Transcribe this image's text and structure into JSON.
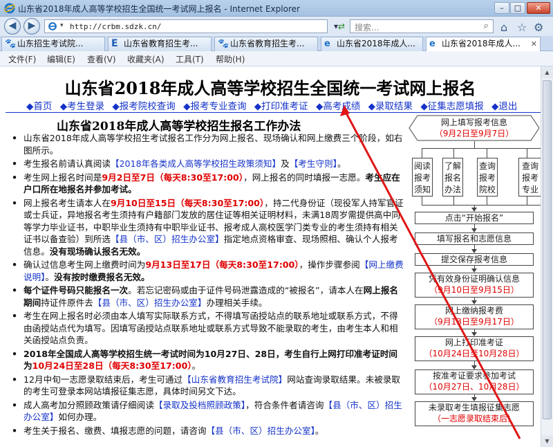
{
  "window": {
    "title": "山东省2018年成人高等学校招生全国统一考试网上报名 - Internet Explorer"
  },
  "address": {
    "url": "http://crbm.sdzk.cn/"
  },
  "search": {
    "placeholder": "搜索..."
  },
  "tabs": [
    {
      "label": "山东招生考试院..."
    },
    {
      "label": "山东省教育招生考..."
    },
    {
      "label": "山东省教育招生考..."
    },
    {
      "label": "山东省2018年成人..."
    },
    {
      "label": "山东省2018年成人..."
    }
  ],
  "menu": [
    "文件(F)",
    "编辑(E)",
    "查看(V)",
    "收藏夹(A)",
    "工具(T)",
    "帮助(H)"
  ],
  "page": {
    "title": "山东省2018年成人高等学校招生全国统一考试网上报名",
    "nav": [
      "◆首页",
      "◆考生登录",
      "◆报考院校查询",
      "◆报考专业查询",
      "◆打印准考证",
      "◆高考成绩",
      "◆录取结果",
      "◆征集志愿填报",
      "◆退出"
    ],
    "heading": "山东省2018年成人高等学校招生报名工作办法",
    "items": [
      {
        "p1": "山东省2018年成人高等学校招生考试报名工作分为网上报名、现场确认和网上缴费三个阶段，如右图所示。"
      },
      {
        "p1": "考生报名前请认真阅读",
        "link1": "【2018年各类成人高等学校招生政策须知】",
        "p2": "及",
        "link2": "【考生守则】",
        "p3": "。"
      },
      {
        "p1": "考生网上报名时间是",
        "r1": "9月2日至7日（每天8:30至17:00）",
        "p2": "，网上报名的同时填报一志愿。",
        "b1": "考生应在户口所在地报名并参加考试。"
      },
      {
        "p1": "网上报名考生请本人在",
        "r1": "9月10日至15日（每天8:30至17:00）",
        "p2": "，持二代身份证（现役军人持军官证或士兵证，异地报名考生须持有户籍部门发放的居住证等相关证明材料，未满18周岁需提供高中同等学力毕业证书，中职毕业生须持有中职毕业证书、报考成人高校医学门类专业的考生须持有相关证书以备查验）到所选",
        "link1": "【县（市、区）招生办公室】",
        "p3": "指定地点资格审查、现场照相、确认个人报考信息。",
        "b1": "没有现场确认报名无效。"
      },
      {
        "p1": "确认过信息考生网上缴费时间为",
        "r1": "9月13日至17日（每天8:30至17:00）",
        "p2": "，操作步骤参阅",
        "link1": "【网上缴费说明】",
        "p3": "。",
        "b1": "没有按时缴费报名无效。"
      },
      {
        "b1": "每个证件号码只能报名一次",
        "p1": "。若忘记密码或由于证件号码泄露造成的“被报名”，请本人在",
        "b2": "网上报名期间",
        "p2": "持证件原件去",
        "link1": "【县（市、区）招生办公室】",
        "p3": "办理相关手续。"
      },
      {
        "p1": "考生在网上报名时必须由本人填写实际联系方式，不得填写函授站点的联系地址或联系方式，不得由函授站点代为填写。因填写函授站点联系地址或联系方式导致不能录取的考生，由考生本人和相关函授站点负责。"
      },
      {
        "b1": "2018年全国成人高等学校招生统一考试时间为10月27日、28日，考生自行上网打印准考证时间为",
        "r1": "10月24日至28日（每天8:30至17:00）",
        "p1": "。"
      },
      {
        "p1": "12月中旬一志愿录取结束后，考生可通过",
        "link1": "【山东省教育招生考试院】",
        "p2": "网站查询录取结果。未被录取的考生可登录本网站填报征集志愿，具体时间另文下达。"
      },
      {
        "p1": "成人高考加分照顾政策请仔细阅读",
        "link1": "【录取及投档照顾政策】",
        "p2": "，符合条件者请咨询",
        "link2": "【县（市、区）招生办公室】",
        "p3": "如何办理。"
      },
      {
        "p1": "考生关于报名、缴费、填报志愿的问题，请咨询",
        "link1": "【县（市、区）招生办公室】",
        "p2": "。"
      }
    ]
  },
  "flow": {
    "top": {
      "label": "网上填写报考信息",
      "sub": "（9月2日至9月7日）"
    },
    "branches": [
      "阅读报考须知",
      "了解报名办法",
      "查询报考院校",
      "查询报考专业"
    ],
    "steps": [
      {
        "label": "点击“开始报名”",
        "sub": ""
      },
      {
        "label": "填写报名和志愿信息",
        "sub": ""
      },
      {
        "label": "提交保存报考信息",
        "sub": ""
      },
      {
        "label": "凭有效身份证明确认信息",
        "sub": "（9月10日至9月15日）"
      },
      {
        "label": "网上缴纳报考费",
        "sub": "（9月13日至9月17日）"
      },
      {
        "label": "网上打印准考证",
        "sub": "（10月24日至10月28日）"
      },
      {
        "label": "按准考证要求参加考试",
        "sub": "（10月27日、10月28日）"
      },
      {
        "label": "未录取考生填报征集志愿",
        "sub": "（一志愿录取结束后）"
      }
    ]
  },
  "colors": {
    "link": "#1533c9",
    "highlight": "#e00000",
    "arrow": "#e01515"
  }
}
